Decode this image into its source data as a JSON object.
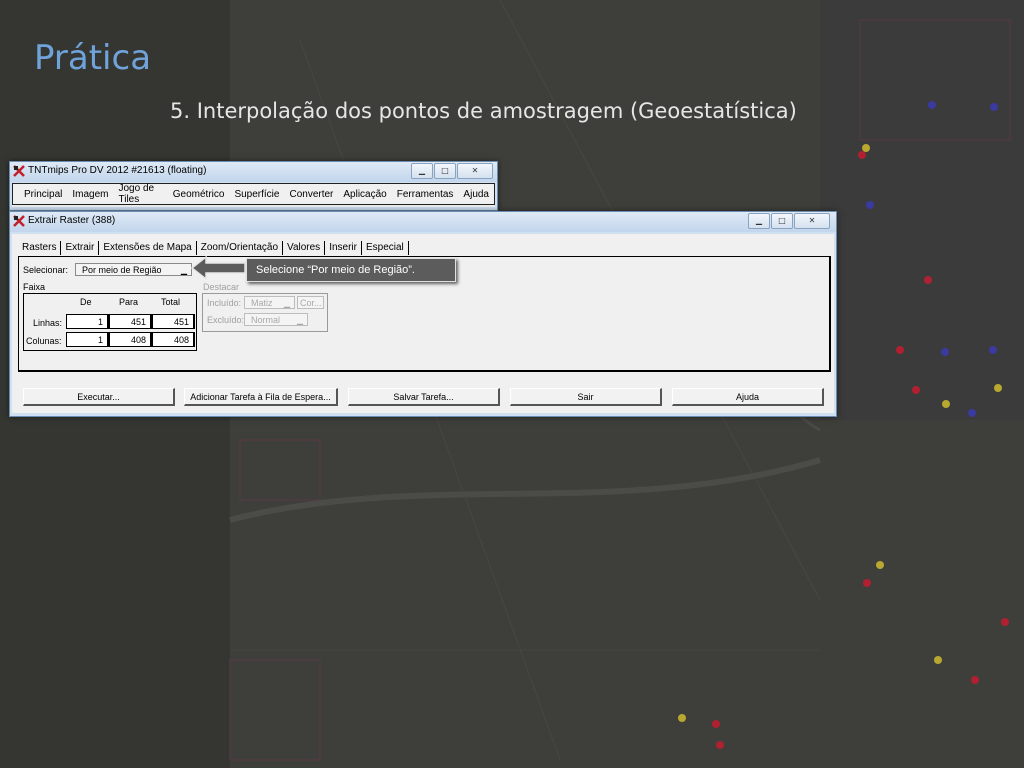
{
  "slide": {
    "title": "Prática",
    "subtitle": "5. Interpolação dos pontos de amostragem (Geoestatística)"
  },
  "main_window": {
    "title": "TNTmips Pro DV 2012  #21613 (floating)",
    "menu": [
      "Principal",
      "Imagem",
      "Jogo de Tiles",
      "Geométrico",
      "Superfície",
      "Converter",
      "Aplicação",
      "Ferramentas",
      "Ajuda"
    ]
  },
  "raster_window": {
    "title": "Extrair Raster (388)",
    "tabs": [
      "Rasters",
      "Extrair",
      "Extensões de Mapa",
      "Zoom/Orientação",
      "Valores",
      "Inserir",
      "Especial"
    ],
    "active_tab": "Extrair",
    "selecionar_label": "Selecionar:",
    "selecionar_value": "Por meio de Região",
    "faixa_label": "Faixa",
    "faixa_headers": [
      "De",
      "Para",
      "Total"
    ],
    "faixa_rows": [
      {
        "label": "Linhas:",
        "de": "1",
        "para": "451",
        "total": "451"
      },
      {
        "label": "Colunas:",
        "de": "1",
        "para": "408",
        "total": "408"
      }
    ],
    "destacar": {
      "label": "Destacar",
      "incluido_label": "Incluído:",
      "incluido_value": "Matiz",
      "cor_label": "Cor...",
      "excluido_label": "Excluído:",
      "excluido_value": "Normal"
    },
    "buttons": [
      "Executar...",
      "Adicionar Tarefa à Fila de Espera...",
      "Salvar Tarefa...",
      "Sair",
      "Ajuda"
    ]
  },
  "callout": "Selecione “Por meio de Região”.",
  "colors": {
    "title_blue": "#6fa3da",
    "callout_bg": "#5c5c5c",
    "titlebar": "#c9dcf0"
  },
  "icons": [
    "tntmips-app-icon",
    "minimize-icon",
    "maximize-icon",
    "close-icon",
    "arrow-left-icon",
    "dropdown-arrow-icon"
  ]
}
